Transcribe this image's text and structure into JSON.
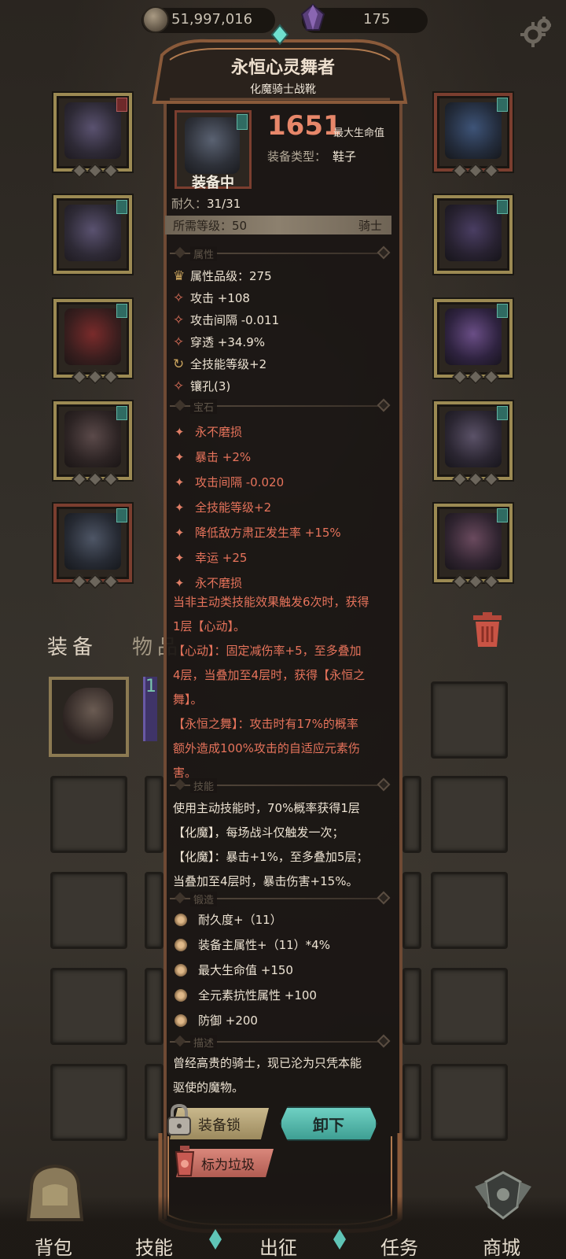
{
  "topbar": {
    "gold_amount": "51,997,016",
    "gem_amount": "175",
    "coin_icon": "coin-icon",
    "gem_icon": "purple-gem-icon",
    "settings_icon": "gear-icon"
  },
  "item": {
    "name": "永恒心灵舞者",
    "subtitle": "化魔骑士战靴",
    "equipped_label": "装备中",
    "main_value": "1651",
    "main_label": "最大生命值",
    "type_label": "装备类型：",
    "type_value": "鞋子",
    "durability_label": "耐久：",
    "durability_value": "31/31",
    "req_level": "所需等级：50",
    "req_class": "骑士"
  },
  "sections": {
    "attributes": "属性",
    "gems": "宝石",
    "skills": "技能",
    "forging": "锻造",
    "description": "描述"
  },
  "attributes": [
    "属性品级：275",
    "攻击 +108",
    "攻击间隔 -0.011",
    "穿透 +34.9%",
    "全技能等级+2",
    "镶孔(3)"
  ],
  "gem_attributes": [
    "永不磨损",
    "暴击 +2%",
    "攻击间隔 -0.020",
    "全技能等级+2",
    "降低敌方肃正发生率 +15%",
    "幸运 +25",
    "永不磨损"
  ],
  "set_effect": {
    "line1": "当非主动类技能效果触发6次时，获得",
    "line2": "1层【心动】。",
    "line3": "【心动】：固定减伤率+5，至多叠加",
    "line4": "4层，当叠加至4层时，获得【永恒之",
    "line5": "舞】。",
    "line6": "【永恒之舞】：攻击时有17%的概率",
    "line7": "额外造成100%攻击的自适应元素伤",
    "line8": "害。"
  },
  "skill_text": {
    "line1": "使用主动技能时，70%概率获得1层",
    "line2": "【化魔】，每场战斗仅触发一次；",
    "line3": "【化魔】：暴击+1%，至多叠加5层；",
    "line4": "当叠加至4层时，暴击伤害+15%。"
  },
  "forging": [
    "耐久度+（11）",
    "装备主属性+（11）*4%",
    "最大生命值 +150",
    "全元素抗性属性 +100",
    "防御 +200"
  ],
  "description": {
    "line1": "曾经高贵的骑士，现已沦为只凭本能",
    "line2": "驱使的魔物。"
  },
  "buttons": {
    "lock": "装备锁",
    "unequip": "卸下",
    "mark_junk": "标为垃圾"
  },
  "bag": {
    "tab_equipment": "装备",
    "tab_items": "物品",
    "item2_count": "1"
  },
  "bottom_nav": {
    "backpack": "背包",
    "skills": "技能",
    "expedition": "出征",
    "quests": "任务",
    "shop": "商城"
  },
  "colors": {
    "accent_red": "#e6735b",
    "accent_teal": "#5fc4b6",
    "gold_text": "#c9a35d"
  }
}
